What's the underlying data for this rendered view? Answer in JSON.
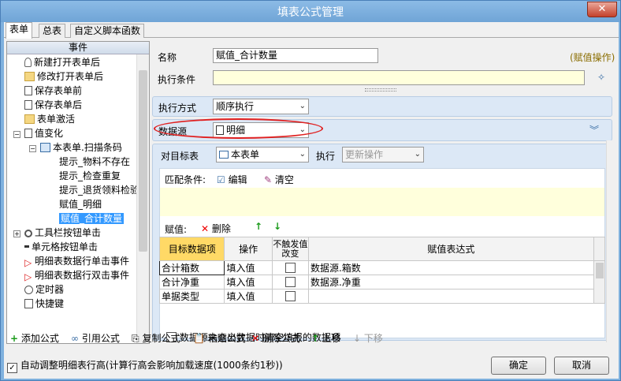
{
  "window": {
    "title": "填表公式管理",
    "close_label": "✕"
  },
  "tabs": [
    {
      "label": "表单"
    },
    {
      "label": "总表"
    },
    {
      "label": "自定义脚本函数"
    }
  ],
  "left_panel": {
    "header": "事件",
    "items": [
      {
        "label": "新建打开表单后"
      },
      {
        "label": "修改打开表单后"
      },
      {
        "label": "保存表单前"
      },
      {
        "label": "保存表单后"
      },
      {
        "label": "表单激活"
      },
      {
        "label": "值变化"
      },
      {
        "label": "本表单.扫描条码"
      },
      {
        "label": "提示_物料不存在"
      },
      {
        "label": "提示_检查重复"
      },
      {
        "label": "提示_退货领料检验"
      },
      {
        "label": "赋值_明细"
      },
      {
        "label": "赋值_合计数量"
      },
      {
        "label": "工具栏按钮单击"
      },
      {
        "label": "单元格按钮单击"
      },
      {
        "label": "明细表数据行单击事件"
      },
      {
        "label": "明细表数据行双击事件"
      },
      {
        "label": "定时器"
      },
      {
        "label": "快捷键"
      }
    ]
  },
  "form": {
    "name_label": "名称",
    "name_value": "赋值_合计数量",
    "op_tag": "(赋值操作)",
    "cond_label": "执行条件",
    "cond_value": "",
    "exec_mode_label": "执行方式",
    "exec_mode_value": "顺序执行",
    "datasource_label": "数据源",
    "datasource_value": "明细",
    "target_label": "对目标表",
    "target_value": "本表单",
    "exec_label": "执行",
    "exec_value": "更新操作",
    "match_label": "匹配条件:",
    "edit_label": "编辑",
    "clear_label": "清空",
    "assign_label": "赋值:",
    "delete_label": "删除",
    "grid_headers": [
      "目标数据项",
      "操作",
      "不触发值改变",
      "赋值表达式"
    ],
    "grid_rows": [
      {
        "target": "合计箱数",
        "op": "填入值",
        "expr": "数据源.箱数"
      },
      {
        "target": "合计净重",
        "op": "填入值",
        "expr": "数据源.净重"
      },
      {
        "target": "单据类型",
        "op": "填入值",
        "expr": ""
      }
    ],
    "clear_check_label": "数据源未查出数据时清空填报的数据项"
  },
  "toolbar": {
    "add": "添加公式",
    "ref": "引用公式",
    "copy": "复制公式",
    "paste": "粘贴公式",
    "delete": "删除公式",
    "up": "上移",
    "down": "下移"
  },
  "bottom": {
    "auto_height_label": "自动调整明细表行高(计算行高会影响加载速度(1000条约1秒))",
    "ok": "确定",
    "cancel": "取消"
  },
  "colors": {
    "accent": "#3399ff",
    "highlight_ellipse": "#e02020",
    "title_bg": "#7fb1de"
  }
}
